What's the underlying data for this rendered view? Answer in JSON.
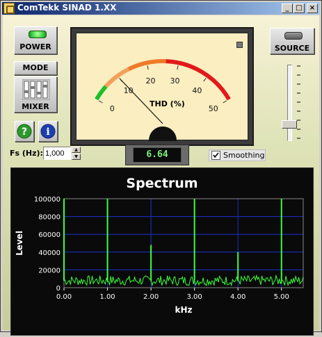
{
  "window": {
    "title": "ComTekk SINAD 1.XX"
  },
  "buttons": {
    "power": "POWER",
    "mode": "MODE",
    "mixer": "MIXER",
    "source": "SOURCE"
  },
  "help_icons": {
    "help": "?",
    "info": "i"
  },
  "fs": {
    "label": "Fs (Hz):",
    "value": "1,000"
  },
  "meter": {
    "label": "THD (%)",
    "ticks": [
      "0",
      "10",
      "20",
      "30",
      "40",
      "50"
    ],
    "needle_value": 10
  },
  "readout": "6.64",
  "smoothing": {
    "label": "Smoothing",
    "checked": true
  },
  "colors": {
    "led": "#3fd64a",
    "display_text": "#7df07d",
    "spectrum_line": "#3cff3c",
    "grid": "#1a2fd6"
  },
  "chart_data": {
    "type": "line",
    "title": "Spectrum",
    "xlabel": "kHz",
    "ylabel": "Level",
    "xlim": [
      0.0,
      5.5
    ],
    "ylim": [
      0,
      100000
    ],
    "x_ticks": [
      "0.00",
      "1.00",
      "2.00",
      "3.00",
      "4.00",
      "5.00"
    ],
    "y_ticks": [
      "0",
      "20000",
      "40000",
      "60000",
      "80000",
      "100000"
    ],
    "grid": true,
    "peaks": [
      {
        "x": 0.0,
        "y": 100000
      },
      {
        "x": 1.0,
        "y": 100000
      },
      {
        "x": 2.0,
        "y": 48000
      },
      {
        "x": 3.0,
        "y": 100000
      },
      {
        "x": 4.0,
        "y": 40000
      },
      {
        "x": 5.0,
        "y": 100000
      }
    ],
    "noise_floor": 8000
  }
}
